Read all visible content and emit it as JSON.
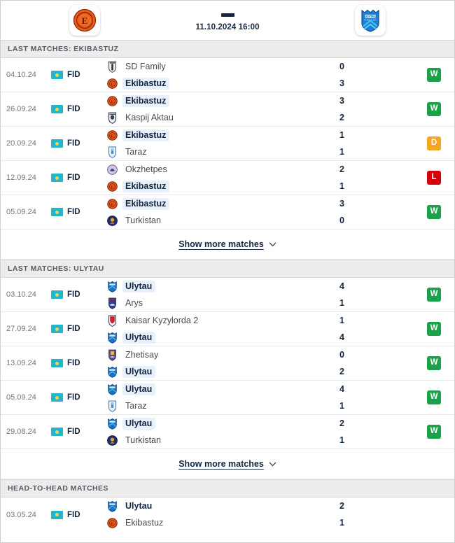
{
  "header": {
    "home_team": "Ekibastuz",
    "away_team": "Ulytau",
    "score_separator": "-",
    "kickoff": "11.10.2024 16:00",
    "home_logo": "ekibastuz-logo",
    "away_logo": "ulytau-logo"
  },
  "colors": {
    "win": "#1ba14a",
    "draw": "#f5a623",
    "loss": "#d9000d",
    "accent_text": "#12263f",
    "section_bg": "#ececec",
    "highlight_bg": "#e8f1fb"
  },
  "sections": [
    {
      "id": "last-matches-ekibastuz",
      "title": "LAST MATCHES: EKIBASTUZ",
      "show_more_label": "Show more matches",
      "matches": [
        {
          "date": "04.10.24",
          "competition": "FID",
          "flag": "kazakhstan-flag",
          "home": "SD Family",
          "away": "Ekibastuz",
          "home_score": "0",
          "away_score": "3",
          "home_highlight": false,
          "away_highlight": true,
          "result": "W",
          "result_color": "#1ba14a"
        },
        {
          "date": "26.09.24",
          "competition": "FID",
          "flag": "kazakhstan-flag",
          "home": "Ekibastuz",
          "away": "Kaspij Aktau",
          "home_score": "3",
          "away_score": "2",
          "home_highlight": true,
          "away_highlight": false,
          "result": "W",
          "result_color": "#1ba14a"
        },
        {
          "date": "20.09.24",
          "competition": "FID",
          "flag": "kazakhstan-flag",
          "home": "Ekibastuz",
          "away": "Taraz",
          "home_score": "1",
          "away_score": "1",
          "home_highlight": true,
          "away_highlight": false,
          "result": "D",
          "result_color": "#f5a623"
        },
        {
          "date": "12.09.24",
          "competition": "FID",
          "flag": "kazakhstan-flag",
          "home": "Okzhetpes",
          "away": "Ekibastuz",
          "home_score": "2",
          "away_score": "1",
          "home_highlight": false,
          "away_highlight": true,
          "result": "L",
          "result_color": "#d9000d"
        },
        {
          "date": "05.09.24",
          "competition": "FID",
          "flag": "kazakhstan-flag",
          "home": "Ekibastuz",
          "away": "Turkistan",
          "home_score": "3",
          "away_score": "0",
          "home_highlight": true,
          "away_highlight": false,
          "result": "W",
          "result_color": "#1ba14a"
        }
      ]
    },
    {
      "id": "last-matches-ulytau",
      "title": "LAST MATCHES: ULYTAU",
      "show_more_label": "Show more matches",
      "matches": [
        {
          "date": "03.10.24",
          "competition": "FID",
          "flag": "kazakhstan-flag",
          "home": "Ulytau",
          "away": "Arys",
          "home_score": "4",
          "away_score": "1",
          "home_highlight": true,
          "away_highlight": false,
          "result": "W",
          "result_color": "#1ba14a"
        },
        {
          "date": "27.09.24",
          "competition": "FID",
          "flag": "kazakhstan-flag",
          "home": "Kaisar Kyzylorda 2",
          "away": "Ulytau",
          "home_score": "1",
          "away_score": "4",
          "home_highlight": false,
          "away_highlight": true,
          "result": "W",
          "result_color": "#1ba14a"
        },
        {
          "date": "13.09.24",
          "competition": "FID",
          "flag": "kazakhstan-flag",
          "home": "Zhetisay",
          "away": "Ulytau",
          "home_score": "0",
          "away_score": "2",
          "home_highlight": false,
          "away_highlight": true,
          "result": "W",
          "result_color": "#1ba14a"
        },
        {
          "date": "05.09.24",
          "competition": "FID",
          "flag": "kazakhstan-flag",
          "home": "Ulytau",
          "away": "Taraz",
          "home_score": "4",
          "away_score": "1",
          "home_highlight": true,
          "away_highlight": false,
          "result": "W",
          "result_color": "#1ba14a"
        },
        {
          "date": "29.08.24",
          "competition": "FID",
          "flag": "kazakhstan-flag",
          "home": "Ulytau",
          "away": "Turkistan",
          "home_score": "2",
          "away_score": "1",
          "home_highlight": true,
          "away_highlight": false,
          "result": "W",
          "result_color": "#1ba14a"
        }
      ]
    },
    {
      "id": "head-to-head-matches",
      "title": "HEAD-TO-HEAD MATCHES",
      "show_more_label": null,
      "matches": [
        {
          "date": "03.05.24",
          "competition": "FID",
          "flag": "kazakhstan-flag",
          "home": "Ulytau",
          "away": "Ekibastuz",
          "home_score": "2",
          "away_score": "1",
          "home_highlight": false,
          "home_bold": true,
          "away_highlight": false,
          "result": null,
          "result_color": null
        }
      ]
    }
  ]
}
